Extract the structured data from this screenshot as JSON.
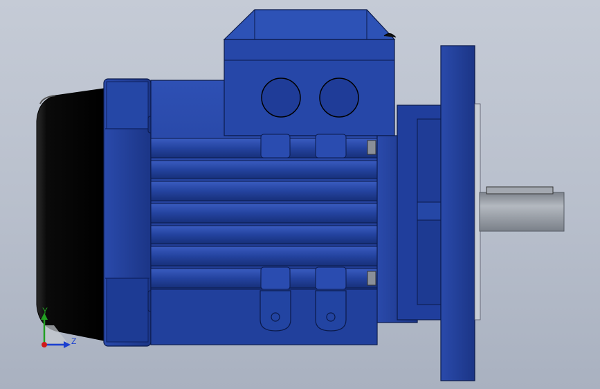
{
  "colors": {
    "background_top": "#c5cbd6",
    "background_bottom": "#a9b1c0",
    "motor_blue": "#22409a",
    "motor_blue_dark": "#14296e",
    "motor_blue_light": "#3556b8",
    "fan_cover": "#050505",
    "shaft_gray": "#9aa0a8",
    "axis_y": "#22a022",
    "axis_z": "#1a3fd0",
    "axis_x": "#d01a1a"
  },
  "triad": {
    "y_label": "Y",
    "z_label": "Z"
  },
  "icons": {
    "origin": "coordinate-triad-icon"
  }
}
